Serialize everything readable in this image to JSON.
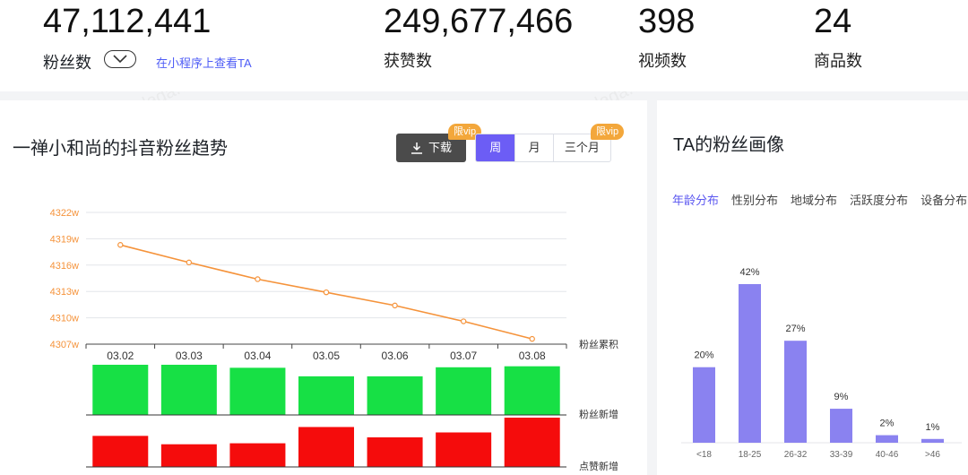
{
  "stats": {
    "fans": {
      "value": "47,112,441",
      "label": "粉丝数",
      "link": "在小程序上查看TA"
    },
    "likes": {
      "value": "249,677,466",
      "label": "获赞数"
    },
    "videos": {
      "value": "398",
      "label": "视频数"
    },
    "products": {
      "value": "24",
      "label": "商品数"
    }
  },
  "trend": {
    "title": "一禅小和尚的抖音粉丝趋势",
    "download_label": "下载",
    "vip_badge": "限vip",
    "periods": [
      "周",
      "月",
      "三个月"
    ],
    "active_period": "周"
  },
  "fans_portrait": {
    "title": "TA的粉丝画像",
    "tabs": [
      "年龄分布",
      "性别分布",
      "地域分布",
      "活跃度分布",
      "设备分布"
    ],
    "active_tab": "年龄分布"
  },
  "watermark_text": "抖大大 doudada.com",
  "colors": {
    "accent": "#6c5df5",
    "line": "#f5933b",
    "green_bar": "#17e045",
    "red_bar": "#f50c0c",
    "age_bar": "#8a82f0",
    "vip": "#f3a73b"
  },
  "chart_data": [
    {
      "type": "line",
      "x": [
        "03.02",
        "03.03",
        "03.04",
        "03.05",
        "03.06",
        "03.07",
        "03.08"
      ],
      "series": [
        {
          "name": "粉丝累积",
          "values": [
            4318.3,
            4316.3,
            4314.4,
            4312.9,
            4311.4,
            4309.6,
            4307.6
          ]
        }
      ],
      "yticks": [
        "4322w",
        "4319w",
        "4316w",
        "4313w",
        "4310w",
        "4307w"
      ],
      "ylim": [
        4307,
        4322
      ],
      "grid": true
    },
    {
      "type": "bar",
      "categories": [
        "03.02",
        "03.03",
        "03.04",
        "03.05",
        "03.06",
        "03.07",
        "03.08"
      ],
      "series": [
        {
          "name": "粉丝新增",
          "values": [
            1.0,
            1.0,
            0.94,
            0.77,
            0.77,
            0.95,
            0.97
          ]
        }
      ]
    },
    {
      "type": "bar",
      "categories": [
        "03.02",
        "03.03",
        "03.04",
        "03.05",
        "03.06",
        "03.07",
        "03.08"
      ],
      "series": [
        {
          "name": "点赞新增",
          "values": [
            0.63,
            0.46,
            0.48,
            0.81,
            0.6,
            0.7,
            1.0
          ]
        }
      ]
    },
    {
      "type": "bar",
      "categories": [
        "<18",
        "18-25",
        "26-32",
        "33-39",
        "40-46",
        ">46"
      ],
      "values": [
        20,
        42,
        27,
        9,
        2,
        1
      ],
      "labels": [
        "20%",
        "42%",
        "27%",
        "9%",
        "2%",
        "1%"
      ],
      "ylim": [
        0,
        42
      ]
    }
  ]
}
